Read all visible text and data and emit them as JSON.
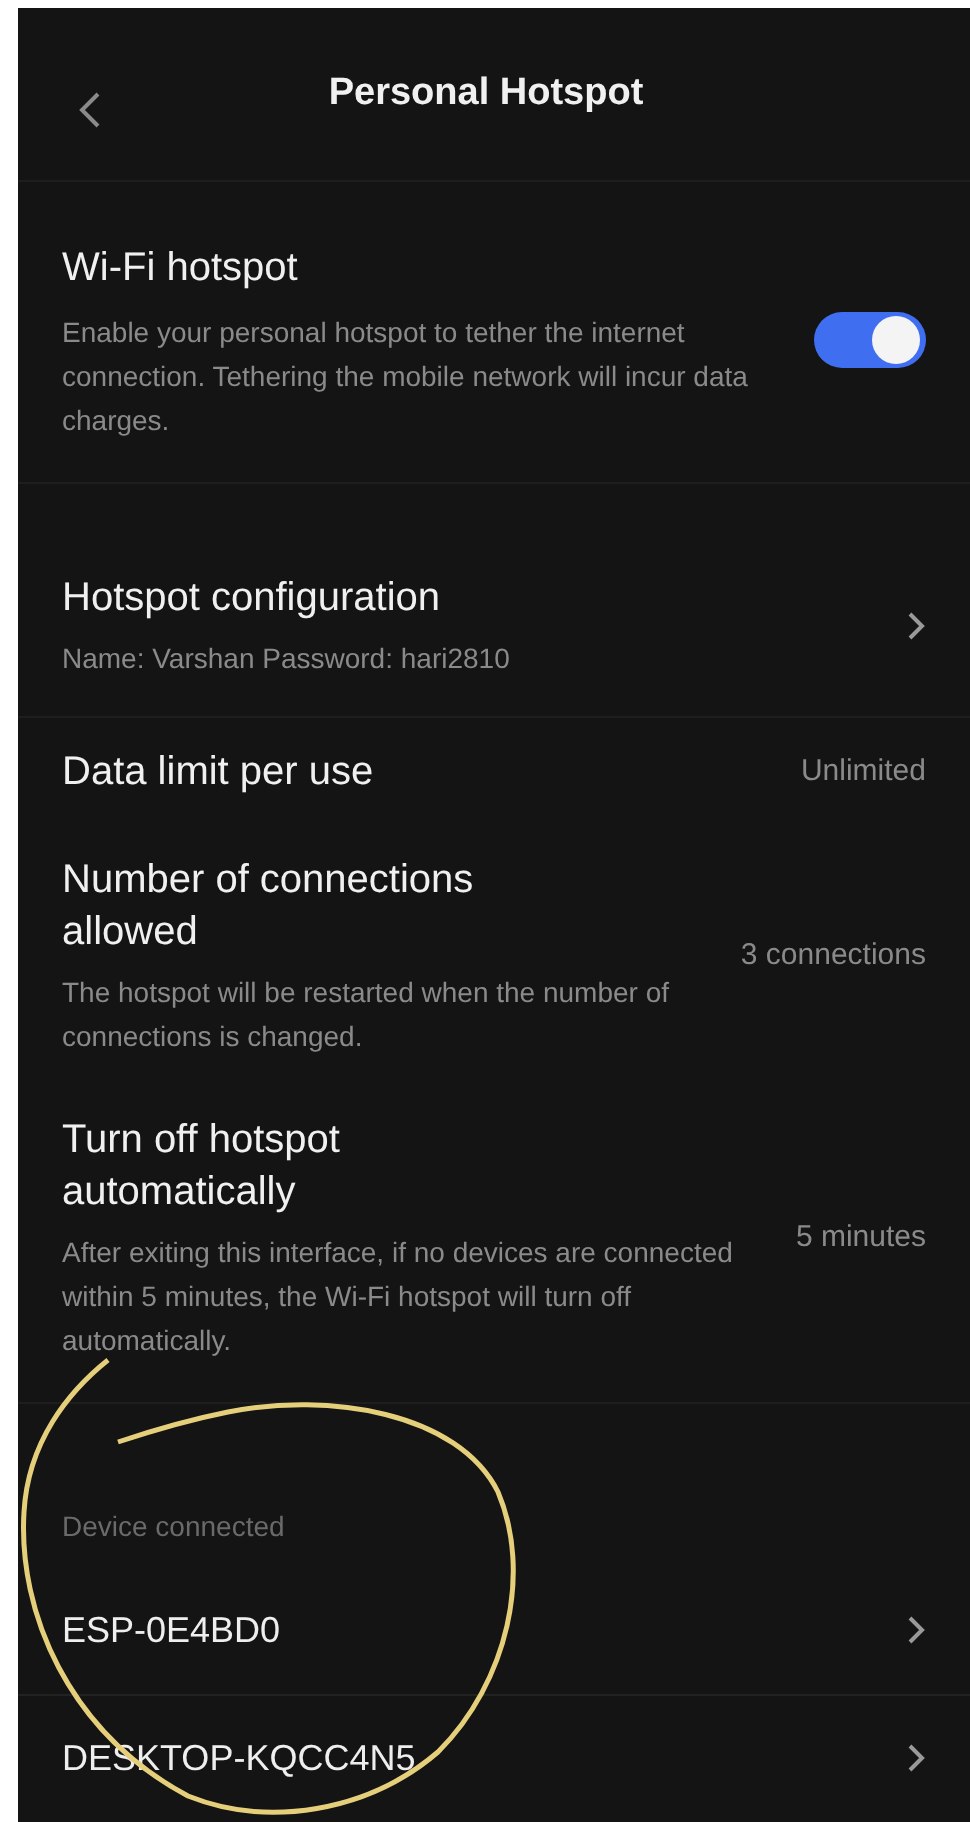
{
  "header": {
    "title": "Personal Hotspot"
  },
  "hotspot": {
    "title": "Wi-Fi hotspot",
    "description": "Enable your personal hotspot to tether the internet connection. Tethering the mobile network will incur data charges.",
    "on": true
  },
  "settings": [
    {
      "kind": "link",
      "title": "Hotspot configuration",
      "description": "Name: Varshan  Password: hari2810"
    },
    {
      "kind": "value",
      "title": "Data limit per use",
      "value": "Unlimited"
    },
    {
      "kind": "value",
      "title": "Number of connections allowed",
      "description": "The hotspot will be restarted when the number of connections is changed.",
      "value": "3 connections"
    },
    {
      "kind": "value",
      "title": "Turn off hotspot automatically",
      "description": "After exiting this interface, if no devices are connected within 5 minutes, the Wi-Fi hotspot will turn off automatically.",
      "value": "5 minutes"
    }
  ],
  "devices": {
    "label": "Device connected",
    "items": [
      {
        "name": "ESP-0E4BD0"
      },
      {
        "name": "DESKTOP-KQCC4N5"
      }
    ]
  }
}
